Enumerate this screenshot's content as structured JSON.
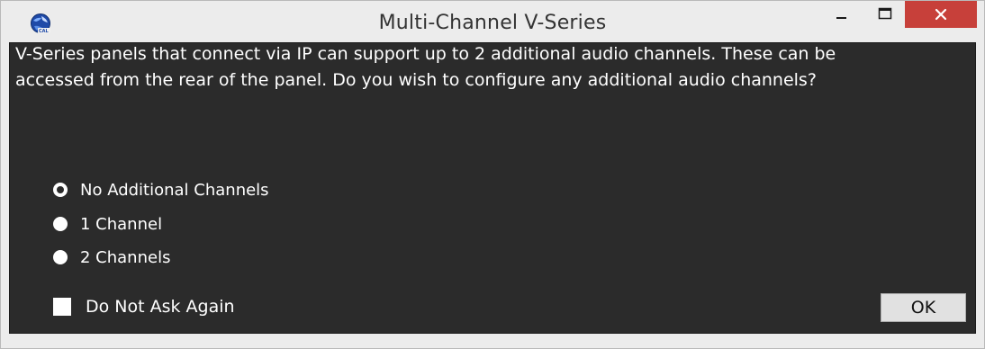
{
  "window": {
    "title": "Multi-Channel V-Series",
    "icon": "app-globe-icon",
    "controls": {
      "minimize": "minimize-icon",
      "maximize": "maximize-icon",
      "close": "close-icon",
      "close_color": "#c7403a"
    }
  },
  "dialog": {
    "message_line1": "V-Series panels that connect via IP can support up to 2 additional audio channels. These can be",
    "message_line2": "accessed from the rear of the panel. Do you wish to configure any additional audio channels?",
    "options": [
      {
        "label": "No Additional Channels",
        "selected": true
      },
      {
        "label": "1 Channel",
        "selected": false
      },
      {
        "label": "2 Channels",
        "selected": false
      }
    ],
    "do_not_ask_again": {
      "label": "Do Not Ask Again",
      "checked": false
    },
    "ok_label": "OK"
  },
  "colors": {
    "panel_background": "#2b2b2b",
    "text": "#ffffff",
    "titlebar": "#ececec"
  }
}
